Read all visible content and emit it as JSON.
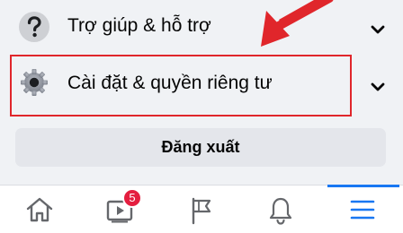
{
  "menu": {
    "help": {
      "label": "Trợ giúp & hỗ trợ",
      "icon": "question-mark-circle-icon"
    },
    "settings": {
      "label": "Cài đặt & quyền riêng tư",
      "icon": "gear-icon"
    },
    "logout_label": "Đăng xuất"
  },
  "tabbar": {
    "tabs": [
      {
        "name": "home",
        "icon": "home-icon"
      },
      {
        "name": "watch",
        "icon": "video-icon",
        "badge": "5"
      },
      {
        "name": "pages",
        "icon": "flag-icon"
      },
      {
        "name": "notifications",
        "icon": "bell-icon"
      },
      {
        "name": "menu",
        "icon": "hamburger-menu-icon",
        "active": true
      }
    ]
  },
  "colors": {
    "background": "#f0f2f5",
    "highlight": "#e0262b",
    "active_tab": "#1877f2",
    "badge": "#e41e3f"
  }
}
